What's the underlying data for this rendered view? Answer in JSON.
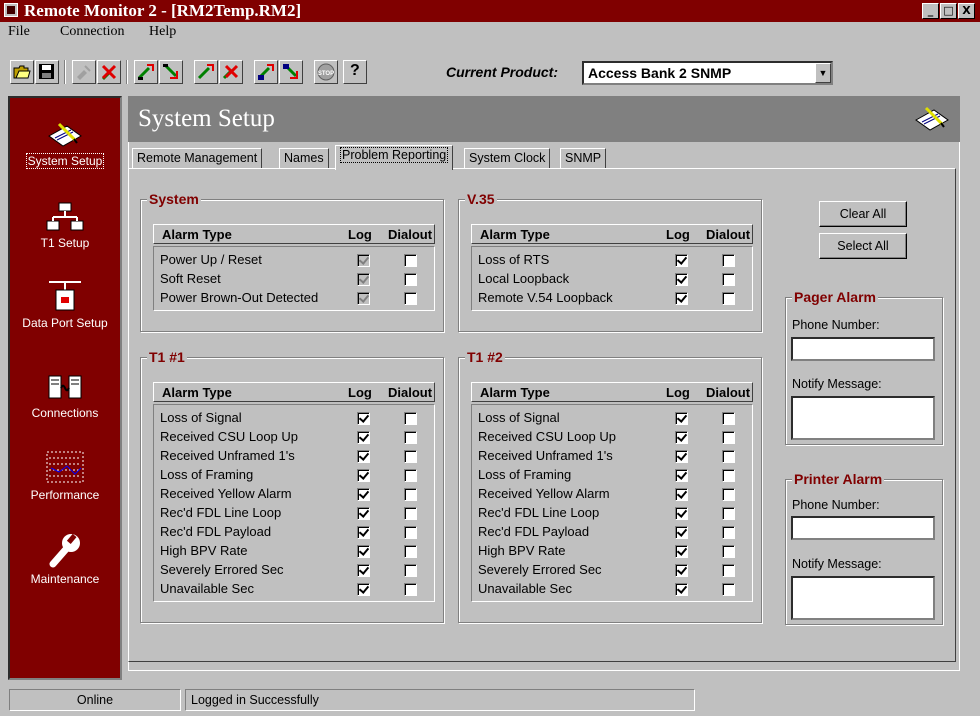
{
  "window": {
    "title": "Remote Monitor 2 - [RM2Temp.RM2]",
    "minimize": "_",
    "restore": "□",
    "close": "X"
  },
  "menu": [
    "File",
    "Connection",
    "Help"
  ],
  "toolbar": {
    "current_product_label": "Current Product:",
    "current_product_value": "Access Bank 2 SNMP",
    "help": "?",
    "stop": "STOP"
  },
  "sidebar": {
    "items": [
      {
        "label": "System Setup",
        "icon": "notepad-icon"
      },
      {
        "label": "T1 Setup",
        "icon": "network-icon"
      },
      {
        "label": "Data Port Setup",
        "icon": "data-port-icon"
      },
      {
        "label": "Connections",
        "icon": "connections-icon"
      },
      {
        "label": "Performance",
        "icon": "performance-icon"
      },
      {
        "label": "Maintenance",
        "icon": "wrench-icon"
      }
    ]
  },
  "page_title": "System Setup",
  "tabs": [
    "Remote Management",
    "Names",
    "Problem Reporting",
    "System Clock",
    "SNMP"
  ],
  "active_tab": "Problem Reporting",
  "columns": {
    "alarm_type": "Alarm Type",
    "log": "Log",
    "dialout": "Dialout"
  },
  "groups": {
    "system": {
      "title": "System",
      "rows": [
        {
          "label": "Power Up / Reset",
          "log": true,
          "dialout": false,
          "disabled": true
        },
        {
          "label": "Soft Reset",
          "log": true,
          "dialout": false,
          "disabled": true
        },
        {
          "label": "Power Brown-Out Detected",
          "log": true,
          "dialout": false,
          "disabled": true
        }
      ]
    },
    "v35": {
      "title": "V.35",
      "rows": [
        {
          "label": "Loss of RTS",
          "log": true,
          "dialout": false
        },
        {
          "label": "Local Loopback",
          "log": true,
          "dialout": false
        },
        {
          "label": "Remote V.54 Loopback",
          "log": true,
          "dialout": false
        }
      ]
    },
    "t1_1": {
      "title": "T1 #1",
      "rows": [
        {
          "label": "Loss of Signal",
          "log": true,
          "dialout": false
        },
        {
          "label": "Received CSU Loop Up",
          "log": true,
          "dialout": false
        },
        {
          "label": "Received Unframed 1's",
          "log": true,
          "dialout": false
        },
        {
          "label": "Loss of Framing",
          "log": true,
          "dialout": false
        },
        {
          "label": "Received Yellow Alarm",
          "log": true,
          "dialout": false
        },
        {
          "label": "Rec'd FDL Line Loop",
          "log": true,
          "dialout": false
        },
        {
          "label": "Rec'd FDL Payload",
          "log": true,
          "dialout": false
        },
        {
          "label": "High BPV Rate",
          "log": true,
          "dialout": false
        },
        {
          "label": "Severely Errored Sec",
          "log": true,
          "dialout": false
        },
        {
          "label": "Unavailable Sec",
          "log": true,
          "dialout": false
        }
      ]
    },
    "t1_2": {
      "title": "T1 #2",
      "rows": [
        {
          "label": "Loss of Signal",
          "log": true,
          "dialout": false
        },
        {
          "label": "Received CSU Loop Up",
          "log": true,
          "dialout": false
        },
        {
          "label": "Received Unframed 1's",
          "log": true,
          "dialout": false
        },
        {
          "label": "Loss of Framing",
          "log": true,
          "dialout": false
        },
        {
          "label": "Received Yellow Alarm",
          "log": true,
          "dialout": false
        },
        {
          "label": "Rec'd FDL Line Loop",
          "log": true,
          "dialout": false
        },
        {
          "label": "Rec'd FDL Payload",
          "log": true,
          "dialout": false
        },
        {
          "label": "High BPV Rate",
          "log": true,
          "dialout": false
        },
        {
          "label": "Severely Errored Sec",
          "log": true,
          "dialout": false
        },
        {
          "label": "Unavailable Sec",
          "log": true,
          "dialout": false
        }
      ]
    }
  },
  "buttons": {
    "clear_all": "Clear All",
    "select_all": "Select All"
  },
  "pager_alarm": {
    "title": "Pager Alarm",
    "phone_label": "Phone Number:",
    "phone_value": "",
    "message_label": "Notify Message:",
    "message_value": ""
  },
  "printer_alarm": {
    "title": "Printer Alarm",
    "phone_label": "Phone Number:",
    "phone_value": "",
    "message_label": "Notify Message:",
    "message_value": ""
  },
  "status": {
    "connection": "Online",
    "message": "Logged in Successfully"
  },
  "colors": {
    "title_bar": "#800000",
    "sidebar": "#800000",
    "group_title": "#800000",
    "header": "#808080",
    "face": "#c0c0c0"
  }
}
